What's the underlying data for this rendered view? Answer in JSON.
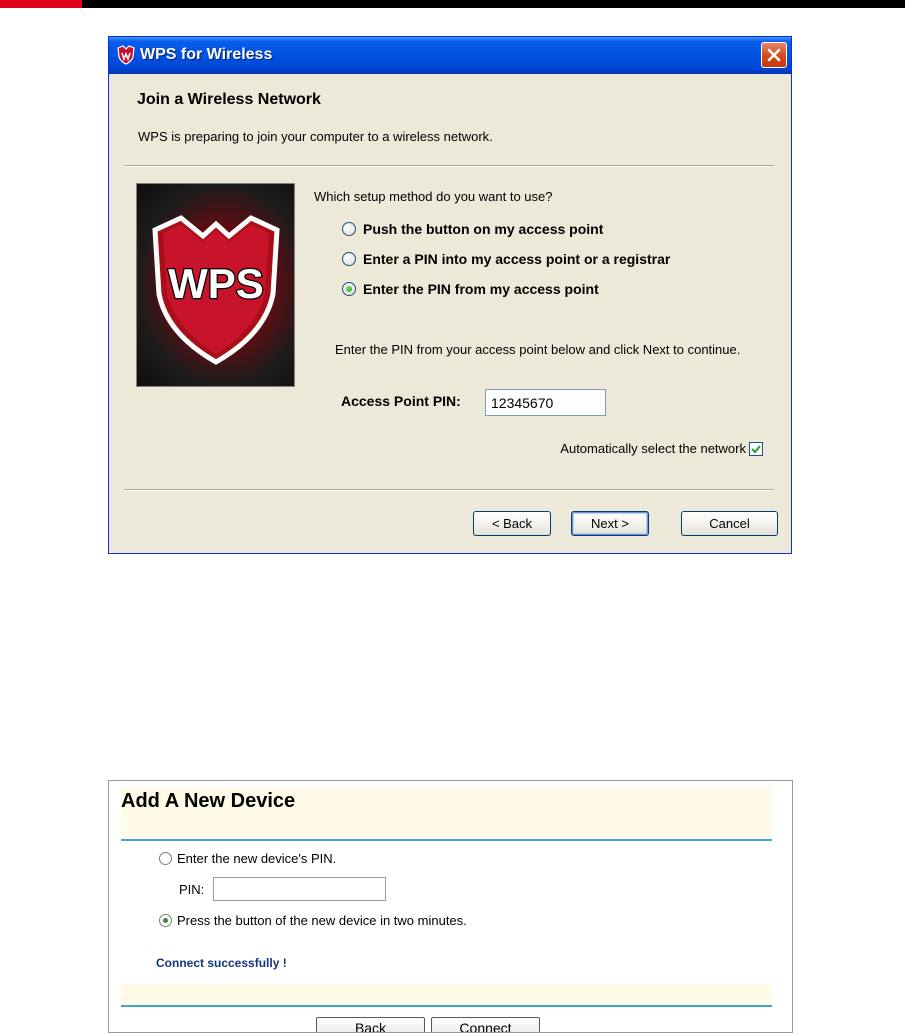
{
  "dialog": {
    "title": "WPS for Wireless",
    "header_title": "Join a Wireless Network",
    "header_subtitle": "WPS is preparing to join your computer to a wireless network.",
    "image_text": "WPS",
    "question": "Which setup method do you want to use?",
    "options": [
      {
        "label": "Push the button on my access point",
        "selected": false
      },
      {
        "label": "Enter a PIN into my access point or a registrar",
        "selected": false
      },
      {
        "label": "Enter the PIN from my access point",
        "selected": true
      }
    ],
    "instruction": "Enter the PIN from your access point below and click Next to continue.",
    "pin_label": "Access Point PIN:",
    "pin_value": "12345670",
    "auto_select_label": "Automatically select the network",
    "auto_select_checked": true,
    "buttons": {
      "back": "< Back",
      "next": "Next >",
      "cancel": "Cancel"
    }
  },
  "panel": {
    "title": "Add A New Device",
    "options": [
      {
        "label": "Enter the new device's PIN.",
        "selected": false
      },
      {
        "label": "Press the button of the new device in two minutes.",
        "selected": true
      }
    ],
    "pin_label": "PIN:",
    "pin_value": "",
    "status": "Connect successfully !",
    "buttons": {
      "back": "Back",
      "connect": "Connect"
    }
  },
  "colors": {
    "accent_red": "#e0001b",
    "xp_title_blue": "#0054e3",
    "dialog_bg": "#ece9d8",
    "panel_line": "#3ea6cf",
    "status_text": "#13367f"
  }
}
